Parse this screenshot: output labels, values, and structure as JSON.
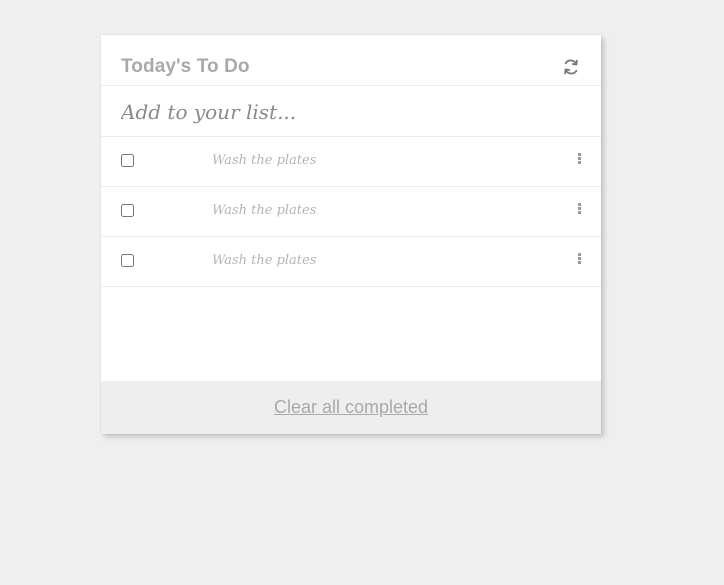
{
  "header": {
    "title": "Today's To Do",
    "refresh_icon": "refresh-icon"
  },
  "add": {
    "placeholder": "Add to your list..."
  },
  "items": [
    {
      "text": "Wash the plates",
      "checked": false
    },
    {
      "text": "Wash the plates",
      "checked": false
    },
    {
      "text": "Wash the plates",
      "checked": false
    }
  ],
  "footer": {
    "clear_label": "Clear all completed"
  },
  "colors": {
    "background": "#efefef",
    "card": "#ffffff",
    "text_muted": "#a9a9a9",
    "footer": "#eeeeee"
  }
}
